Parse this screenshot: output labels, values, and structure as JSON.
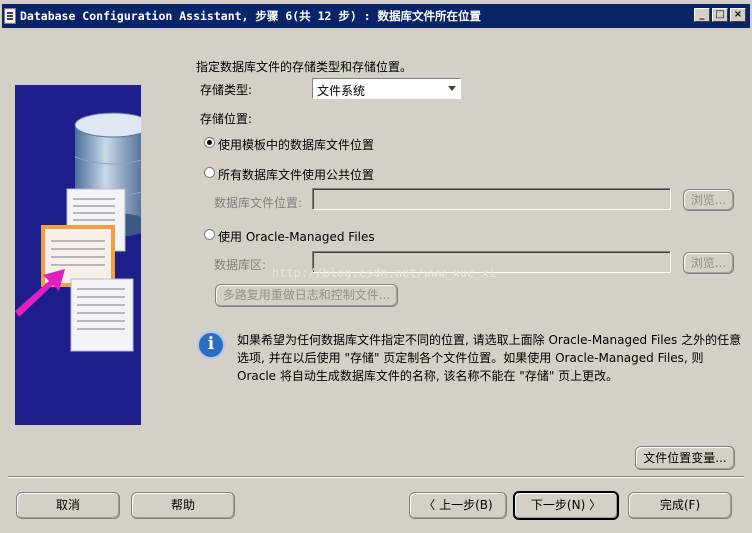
{
  "window": {
    "title": "Database Configuration Assistant, 步骤 6(共 12 步) : 数据库文件所在位置",
    "min_glyph": "_",
    "max_glyph": "□",
    "close_glyph": "×"
  },
  "form": {
    "prompt": "指定数据库文件的存储类型和存储位置。",
    "storage_type_label": "存储类型:",
    "storage_type_value": "文件系统",
    "storage_location_label": "存储位置:",
    "options": [
      {
        "label": "使用模板中的数据库文件位置",
        "selected": true
      },
      {
        "label": "所有数据库文件使用公共位置",
        "selected": false
      },
      {
        "label": "使用 Oracle-Managed Files",
        "selected": false
      }
    ],
    "db_file_location_label": "数据库文件位置:",
    "db_area_label": "数据库区:",
    "browse_label": "浏览...",
    "multiplex_button": "多路复用重做日志和控制文件..."
  },
  "info": {
    "icon": "info-icon",
    "icon_glyph": "i",
    "line1": "如果希望为任何数据库文件指定不同的位置, 请选取上面除 Oracle-Managed Files 之外的任意",
    "line2": "选项, 并在以后使用 \"存储\" 页定制各个文件位置。如果使用 Oracle-Managed Files, 则",
    "line3": "Oracle 将自动生成数据库文件的名称, 该名称不能在 \"存储\" 页上更改。"
  },
  "watermark": "http://blog.csdn.net/www_xue_xi",
  "footer": {
    "file_location_vars": "文件位置变量...",
    "cancel": "取消",
    "help": "帮助",
    "back": "上一步(B)",
    "next": "下一步(N)",
    "finish": "完成(F)",
    "back_chevron": "〈",
    "next_chevron": "〉"
  }
}
